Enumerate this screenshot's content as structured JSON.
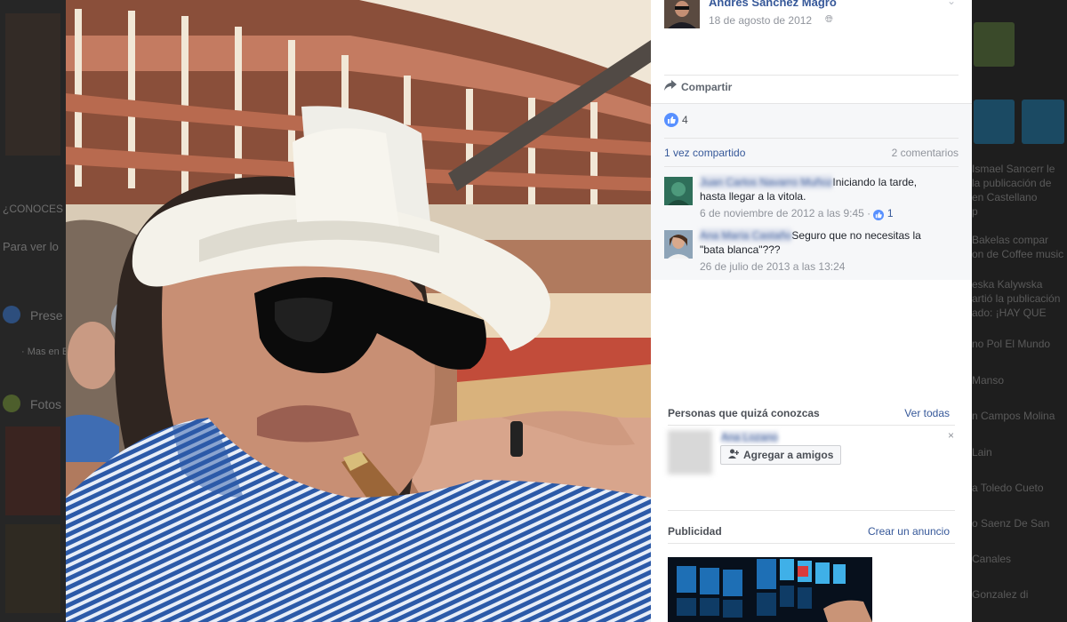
{
  "photo": {
    "subject": "man-hat-sunglasses-cigar"
  },
  "post": {
    "author": "Andres Sanchez Magro",
    "date": "18 de agosto de 2012",
    "share_label": "Compartir",
    "likes": "4",
    "shares": "1 vez compartido",
    "comments_count": "2 comentarios"
  },
  "comments": [
    {
      "name": "Juan Carlos Navarro Muñoz",
      "text": "Iniciando la tarde, hasta llegar a la vitola.",
      "meta": "6 de noviembre de 2012 a las 9:45 · ",
      "likes": "1"
    },
    {
      "name": "Ana María Castaño",
      "text": "Seguro que no necesitas la \"bata blanca\"???",
      "meta": "26 de julio de 2013 a las 13:24",
      "likes": ""
    }
  ],
  "pymk": {
    "title": "Personas que quizá conozcas",
    "see_all": "Ver todas",
    "person_name": "Ana Lozano",
    "add_label": "Agregar a amigos",
    "close": "×"
  },
  "ads": {
    "title": "Publicidad",
    "create": "Crear un anuncio"
  },
  "background": {
    "left_items": [
      "¿CONOCES",
      "Para ver lo",
      "Prese",
      "· Mas en E",
      "Fotos"
    ],
    "right_items": [
      "Ismael Sancerr le",
      "la publicación de",
      "en Castellano",
      "p",
      "Bakelas compar",
      "on de Coffee music",
      "eska Kalywska",
      "artió la publicación",
      "ado: ¡HAY QUE",
      "no Pol El Mundo",
      "Manso",
      "n Campos Molina",
      "Lain",
      "a Toledo Cueto",
      "o Saenz De San",
      "Canales",
      "Gonzalez di"
    ]
  },
  "colors": {
    "link": "#365899",
    "like": "#5890ff",
    "meta": "#90949c"
  }
}
